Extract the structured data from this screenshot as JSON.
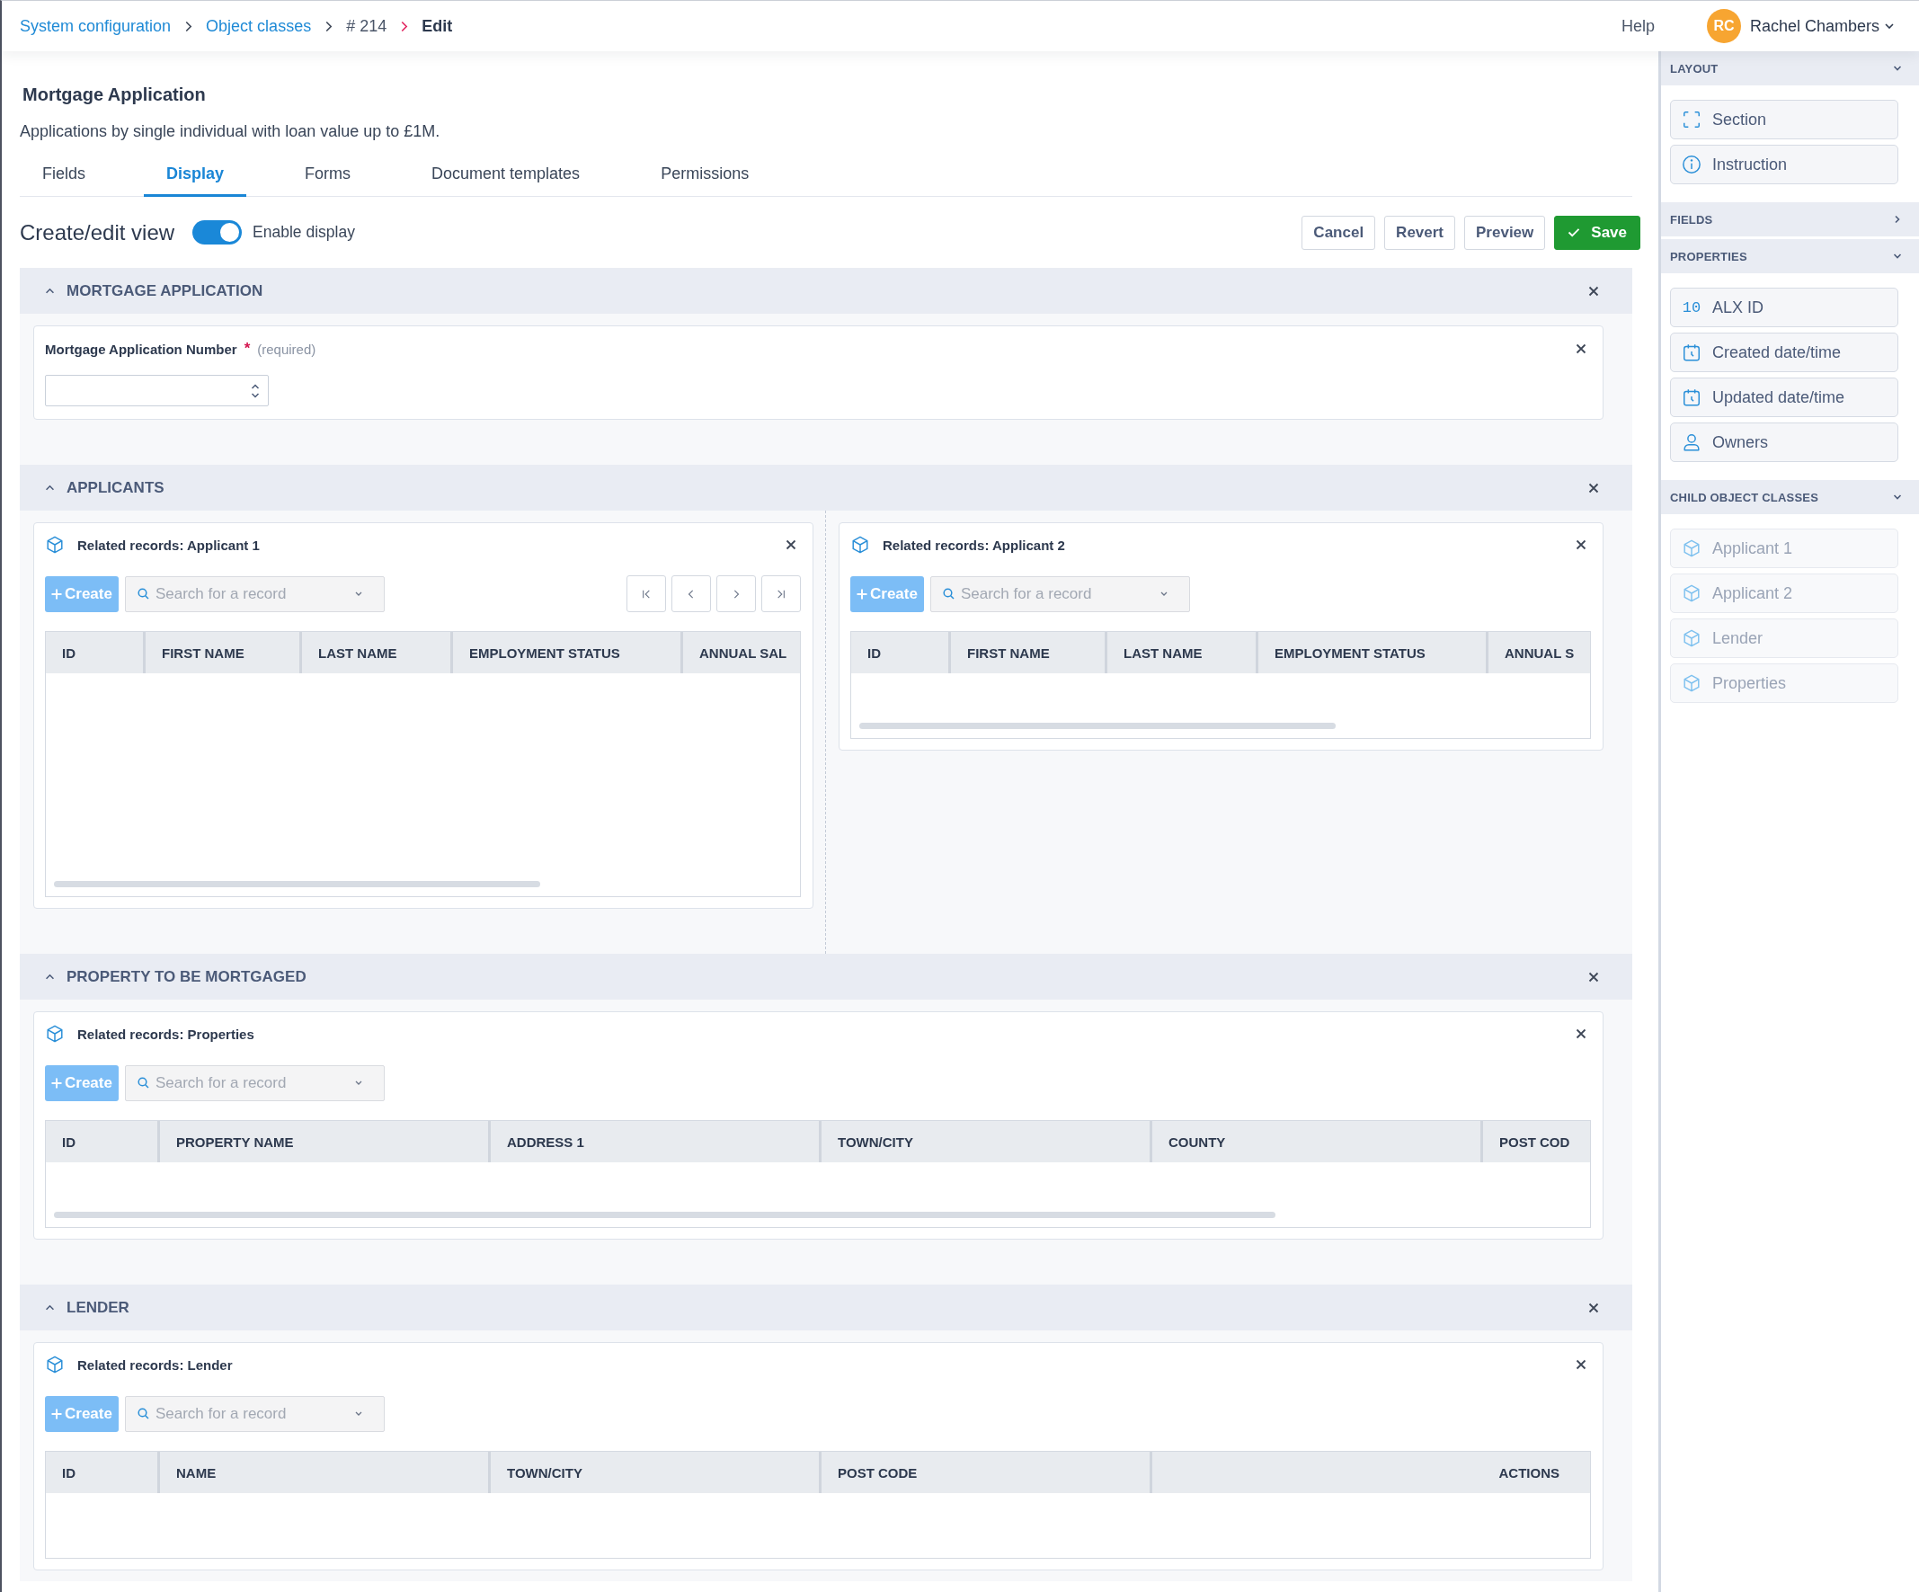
{
  "top_bar": {
    "breadcrumb": [
      {
        "label": "System configuration",
        "kind": "link"
      },
      {
        "label": "Object classes",
        "kind": "link"
      },
      {
        "label": "# 214",
        "kind": "text"
      },
      {
        "label": "Edit",
        "kind": "current"
      }
    ],
    "help": "Help",
    "user": {
      "initials": "RC",
      "name": "Rachel Chambers"
    }
  },
  "header": {
    "title": "Mortgage Application",
    "description": "Applications by single individual with loan value up to £1M."
  },
  "tabs": [
    {
      "label": "Fields",
      "selected": false
    },
    {
      "label": "Display",
      "selected": true
    },
    {
      "label": "Forms",
      "selected": false
    },
    {
      "label": "Document templates",
      "selected": false
    },
    {
      "label": "Permissions",
      "selected": false
    }
  ],
  "view_bar": {
    "title": "Create/edit view",
    "toggle": {
      "label": "Enable display",
      "on": true
    },
    "buttons": [
      {
        "label": "Cancel",
        "kind": "secondary"
      },
      {
        "label": "Revert",
        "kind": "secondary"
      },
      {
        "label": "Preview",
        "kind": "secondary"
      },
      {
        "label": "Save",
        "kind": "primary"
      }
    ]
  },
  "sections": [
    {
      "title": "MORTGAGE APPLICATION",
      "expanded": true,
      "columns": [
        [
          {
            "kind": "number_field",
            "label": "Mortgage Application Number",
            "required_mark": "*",
            "hint": "(required)"
          }
        ]
      ]
    },
    {
      "title": "APPLICANTS",
      "expanded": true,
      "columns": [
        [
          {
            "kind": "related",
            "title": "Related records: Applicant 1",
            "create_label": "Create",
            "search_placeholder": "Search for a record",
            "pager": true,
            "table": {
              "columns": [
                {
                  "label": "ID",
                  "kind": "data"
                },
                {
                  "label": "FIRST NAME",
                  "kind": "data"
                },
                {
                  "label": "LAST NAME",
                  "kind": "data"
                },
                {
                  "label": "EMPLOYMENT STATUS",
                  "kind": "data"
                },
                {
                  "label": "ANNUAL SAL",
                  "kind": "data"
                }
              ],
              "scrollbar": true
            }
          }
        ],
        [
          {
            "kind": "related",
            "title": "Related records: Applicant 2",
            "create_label": "Create",
            "search_placeholder": "Search for a record",
            "pager": false,
            "table": {
              "columns": [
                {
                  "label": "ID",
                  "kind": "data"
                },
                {
                  "label": "FIRST NAME",
                  "kind": "data"
                },
                {
                  "label": "LAST NAME",
                  "kind": "data"
                },
                {
                  "label": "EMPLOYMENT STATUS",
                  "kind": "data"
                },
                {
                  "label": "ANNUAL S",
                  "kind": "data"
                }
              ],
              "scrollbar": true
            }
          }
        ]
      ]
    },
    {
      "title": "PROPERTY TO BE MORTGAGED",
      "expanded": true,
      "columns": [
        [
          {
            "kind": "related",
            "title": "Related records: Properties",
            "create_label": "Create",
            "search_placeholder": "Search for a record",
            "pager": false,
            "table": {
              "columns": [
                {
                  "label": "ID",
                  "kind": "data"
                },
                {
                  "label": "PROPERTY NAME",
                  "kind": "data"
                },
                {
                  "label": "ADDRESS 1",
                  "kind": "data"
                },
                {
                  "label": "TOWN/CITY",
                  "kind": "data"
                },
                {
                  "label": "COUNTY",
                  "kind": "data"
                },
                {
                  "label": "POST COD",
                  "kind": "data"
                }
              ],
              "scrollbar": true
            }
          }
        ]
      ]
    },
    {
      "title": "LENDER",
      "expanded": true,
      "columns": [
        [
          {
            "kind": "related",
            "title": "Related records: Lender",
            "create_label": "Create",
            "search_placeholder": "Search for a record",
            "pager": false,
            "table": {
              "columns": [
                {
                  "label": "ID",
                  "kind": "data"
                },
                {
                  "label": "NAME",
                  "kind": "data"
                },
                {
                  "label": "TOWN/CITY",
                  "kind": "data"
                },
                {
                  "label": "POST CODE",
                  "kind": "data"
                },
                {
                  "label": "ACTIONS",
                  "kind": "actions"
                }
              ],
              "scrollbar": false
            }
          }
        ]
      ]
    }
  ],
  "sidebar": {
    "groups": [
      {
        "title": "LAYOUT",
        "expanded": true,
        "items": [
          {
            "label": "Section",
            "kind": "section",
            "disabled": false
          },
          {
            "label": "Instruction",
            "kind": "instruction",
            "disabled": false
          }
        ]
      },
      {
        "title": "FIELDS",
        "expanded": false
      },
      {
        "title": "PROPERTIES",
        "expanded": true,
        "items": [
          {
            "label": "ALX ID",
            "kind": "number",
            "icon_text": "10",
            "disabled": false
          },
          {
            "label": "Created date/time",
            "kind": "datetime",
            "disabled": false
          },
          {
            "label": "Updated date/time",
            "kind": "datetime",
            "disabled": false
          },
          {
            "label": "Owners",
            "kind": "user",
            "disabled": false
          }
        ]
      },
      {
        "title": "CHILD OBJECT CLASSES",
        "expanded": true,
        "items": [
          {
            "label": "Applicant 1",
            "kind": "child",
            "disabled": true
          },
          {
            "label": "Applicant 2",
            "kind": "child",
            "disabled": true
          },
          {
            "label": "Lender",
            "kind": "child",
            "disabled": true
          },
          {
            "label": "Properties",
            "kind": "child",
            "disabled": true
          }
        ]
      }
    ]
  }
}
